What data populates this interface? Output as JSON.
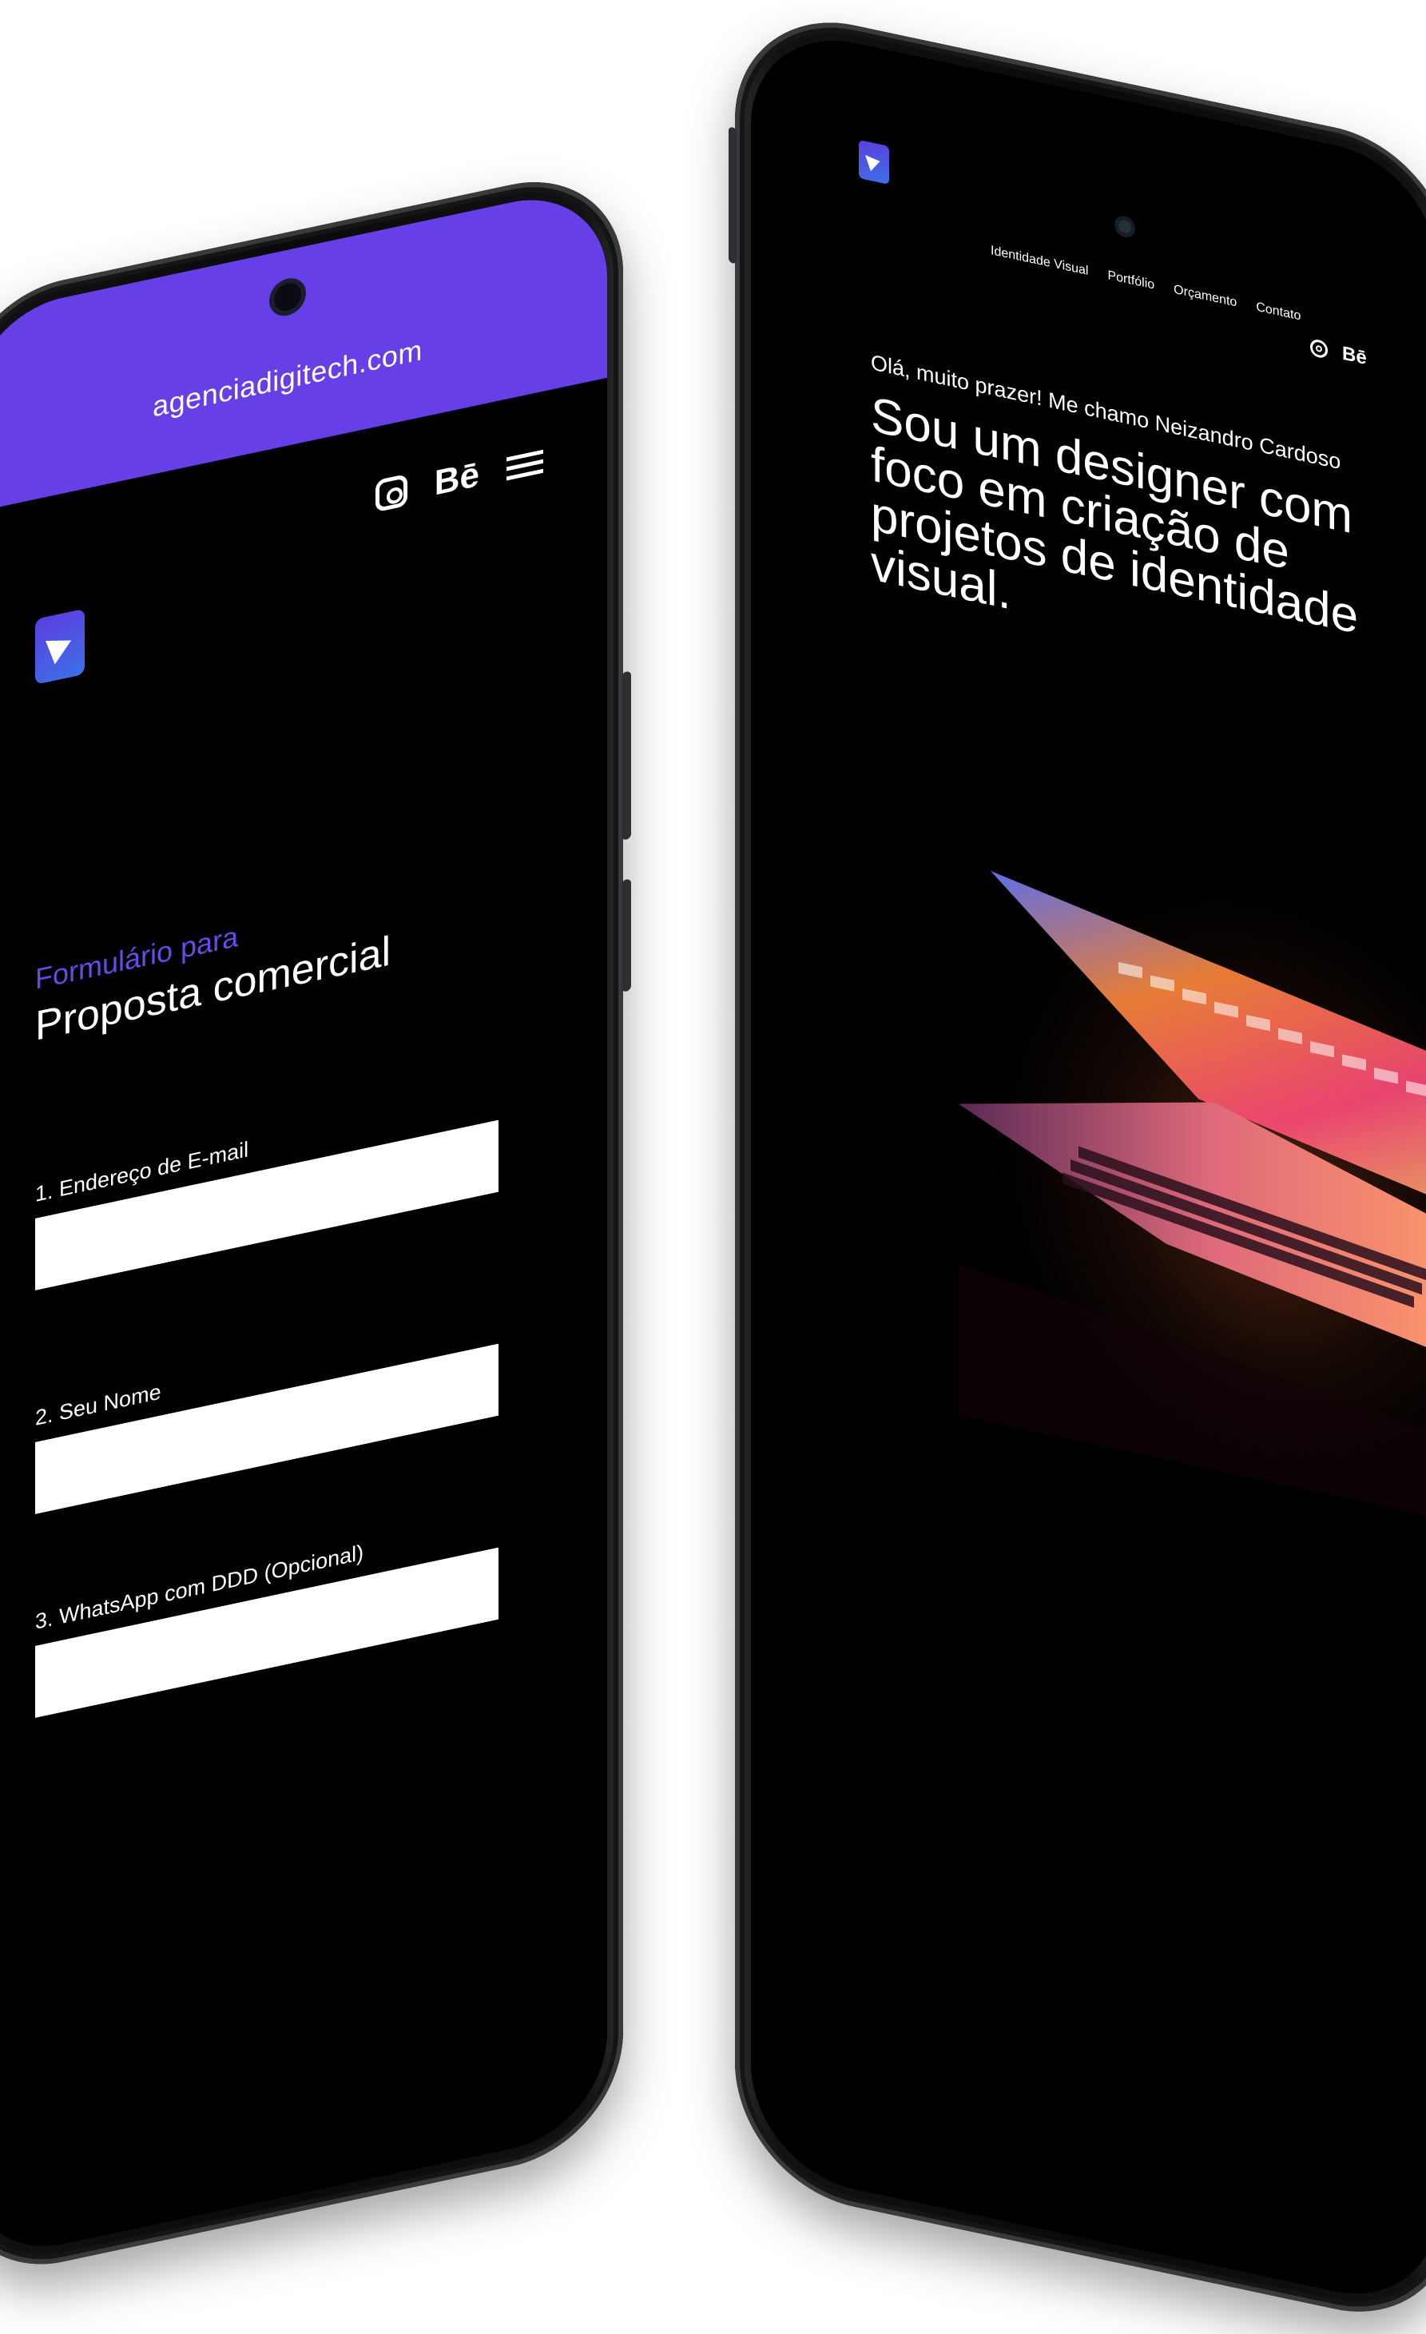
{
  "left_phone": {
    "url": "agenciadigitech.com",
    "form_kicker": "Formulário para",
    "form_title": "Proposta comercial",
    "fields": [
      {
        "label": "1. Endereço de E-mail",
        "value": ""
      },
      {
        "label": "2. Seu Nome",
        "value": ""
      },
      {
        "label": "3. WhatsApp com DDD (Opcional)",
        "value": ""
      }
    ],
    "header_icons": [
      "instagram-icon",
      "behance-icon",
      "menu-icon"
    ],
    "accent_color": "#6640e6"
  },
  "right_phone": {
    "nav": [
      "Identidade Visual",
      "Portfólio",
      "Orçamento",
      "Contato"
    ],
    "social_icons": [
      "instagram-icon",
      "behance-icon"
    ],
    "greeting": "Olá, muito prazer! Me chamo Neizandro Cardoso",
    "headline": "Sou um designer com foco em criação de projetos de identidade visual.",
    "hero_image": "laptop-keyboard-illustration"
  },
  "icons": {
    "behance": "Bē"
  }
}
